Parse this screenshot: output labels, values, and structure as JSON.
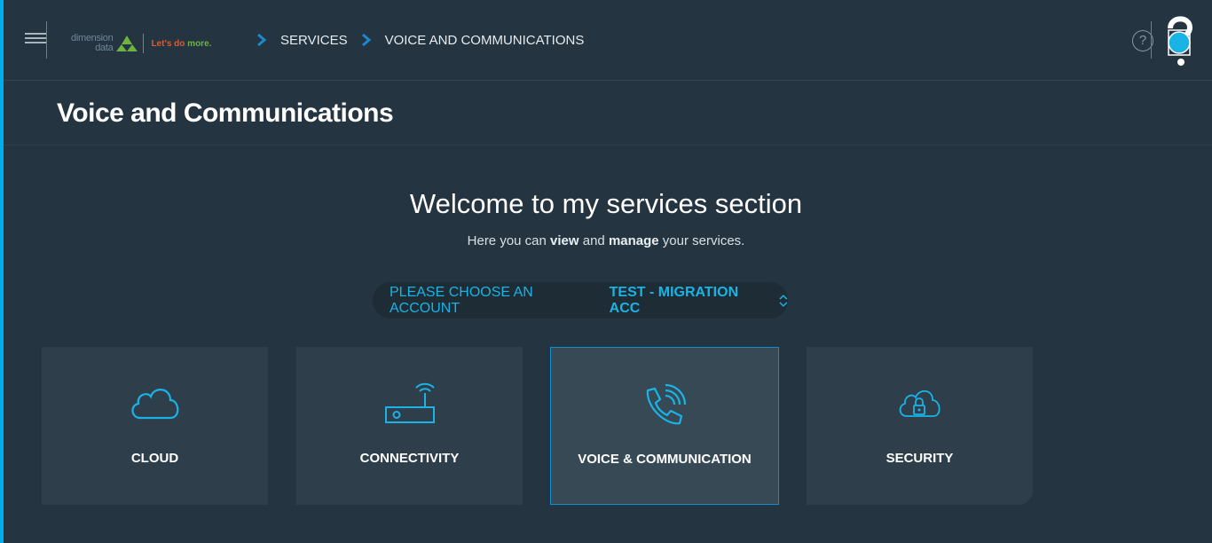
{
  "header": {
    "logo": {
      "line1": "dimension",
      "line2": "data",
      "tag_prefix": "Let's do ",
      "tag_suffix": "more."
    },
    "breadcrumb": [
      {
        "label": "SERVICES"
      },
      {
        "label": "VOICE AND COMMUNICATIONS"
      }
    ],
    "help_label": "?"
  },
  "page": {
    "title": "Voice and Communications"
  },
  "welcome": {
    "title": "Welcome to my services section",
    "sub_prefix": "Here you can ",
    "sub_view": "view",
    "sub_and": " and ",
    "sub_manage": "manage",
    "sub_suffix": " your services."
  },
  "account": {
    "label": "PLEASE CHOOSE AN ACCOUNT",
    "selected": "TEST - MIGRATION ACC"
  },
  "cards": [
    {
      "label": "CLOUD",
      "icon": "cloud-icon"
    },
    {
      "label": "CONNECTIVITY",
      "icon": "router-icon"
    },
    {
      "label": "VOICE & COMMUNICATION",
      "icon": "phone-call-icon",
      "active": true
    },
    {
      "label": "SECURITY",
      "icon": "cloud-lock-icon"
    }
  ],
  "colors": {
    "background": "#243441",
    "card": "#2e3e4a",
    "accent": "#1ab3e6",
    "active_border": "#0f8ed0"
  }
}
